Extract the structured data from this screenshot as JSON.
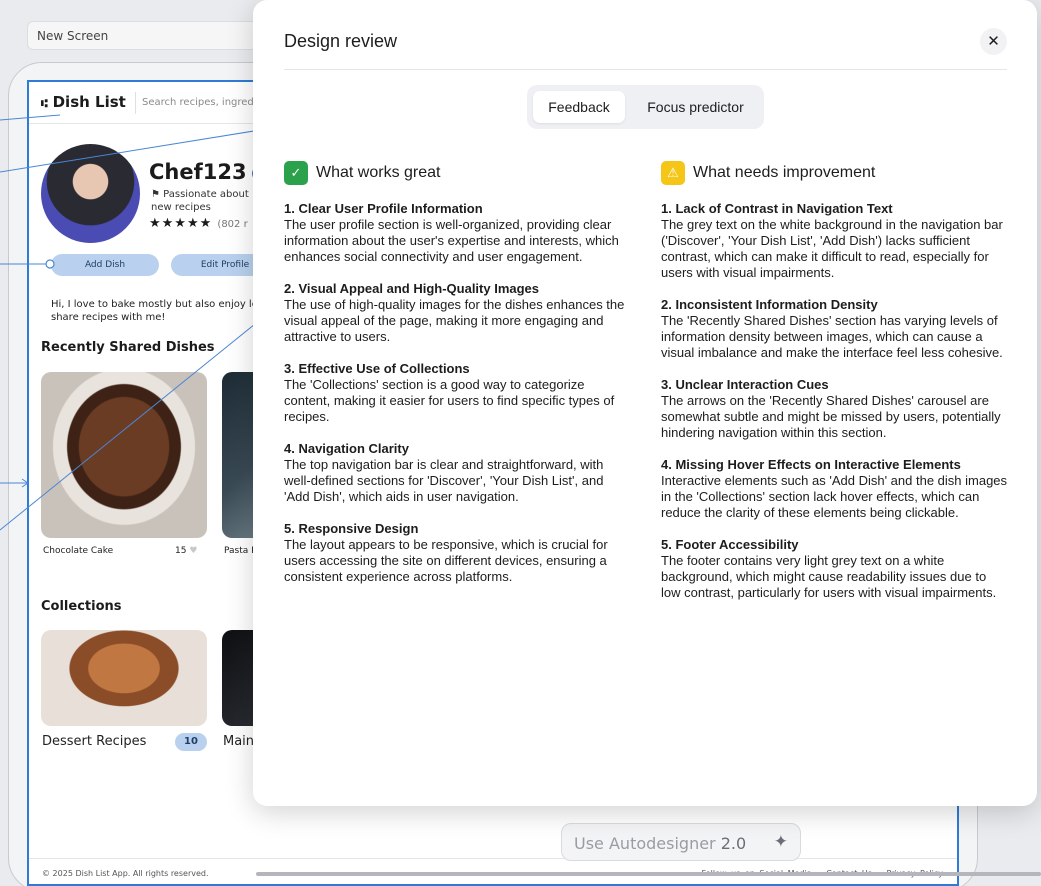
{
  "canvas": {
    "screen_name": "New Screen",
    "app_logo": "Dish List",
    "search_placeholder": "Search recipes, ingredients",
    "profile": {
      "name": "Chef123",
      "bio": "Passionate about new recipes",
      "rating_count": "(802 r",
      "add_dish": "Add Dish",
      "edit_profile": "Edit Profile",
      "about": "Hi, I love to bake mostly but also enjoy le share recipes with me!"
    },
    "recent_title": "Recently Shared Dishes",
    "dishes": [
      {
        "name": "Chocolate Cake",
        "likes": "15"
      },
      {
        "name": "Pasta P"
      }
    ],
    "collections_title": "Collections",
    "collections": [
      {
        "name": "Dessert Recipes",
        "count": "10"
      },
      {
        "name": "Main"
      }
    ],
    "footer": {
      "copyright": "© 2025 Dish List App. All rights reserved.",
      "links": [
        "Follow us on Social Media",
        "Contact Us",
        "Privacy Policy"
      ]
    },
    "autodesigner": {
      "label": "Use Autodesigner",
      "version": "2.0"
    }
  },
  "modal": {
    "title": "Design review",
    "tabs": [
      {
        "label": "Feedback",
        "active": true
      },
      {
        "label": "Focus predictor",
        "active": false
      }
    ],
    "works": {
      "heading": "What works great",
      "icon": "check-icon",
      "color": "#2aa14a",
      "items": [
        {
          "title": "1. Clear User Profile Information",
          "body": "The user profile section is well-organized, providing clear information about the user's expertise and interests, which enhances social connectivity and user engagement."
        },
        {
          "title": "2. Visual Appeal and High-Quality Images",
          "body": "The use of high-quality images for the dishes enhances the visual appeal of the page, making it more engaging and attractive to users."
        },
        {
          "title": "3. Effective Use of Collections",
          "body": "The 'Collections' section is a good way to categorize content, making it easier for users to find specific types of recipes."
        },
        {
          "title": "4. Navigation Clarity",
          "body": "The top navigation bar is clear and straightforward, with well-defined sections for 'Discover', 'Your Dish List', and 'Add Dish', which aids in user navigation."
        },
        {
          "title": "5. Responsive Design",
          "body": "The layout appears to be responsive, which is crucial for users accessing the site on different devices, ensuring a consistent experience across platforms."
        }
      ]
    },
    "improve": {
      "heading": "What needs improvement",
      "icon": "warning-icon",
      "color": "#f5c518",
      "items": [
        {
          "title": "1. Lack of Contrast in Navigation Text",
          "body": "The grey text on the white background in the navigation bar ('Discover', 'Your Dish List', 'Add Dish') lacks sufficient contrast, which can make it difficult to read, especially for users with visual impairments."
        },
        {
          "title": "2. Inconsistent Information Density",
          "body": "The 'Recently Shared Dishes' section has varying levels of information density between images, which can cause a visual imbalance and make the interface feel less cohesive."
        },
        {
          "title": "3. Unclear Interaction Cues",
          "body": "The arrows on the 'Recently Shared Dishes' carousel are somewhat subtle and might be missed by users, potentially hindering navigation within this section."
        },
        {
          "title": "4. Missing Hover Effects on Interactive Elements",
          "body": "Interactive elements such as 'Add Dish' and the dish images in the 'Collections' section lack hover effects, which can reduce the clarity of these elements being clickable."
        },
        {
          "title": "5. Footer Accessibility",
          "body": "The footer contains very light grey text on a white background, which might cause readability issues due to low contrast, particularly for users with visual impairments."
        }
      ]
    }
  }
}
